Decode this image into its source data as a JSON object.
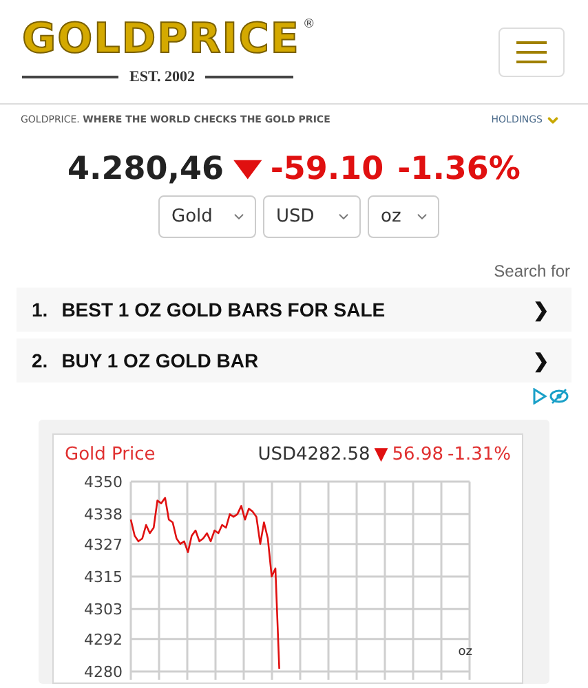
{
  "header": {
    "logo": "GOLDPRICE",
    "registered": "®",
    "established": "EST. 2002"
  },
  "tagline": "GOLDPRICE. **WHERE THE WORLD CHECKS THE GOLD PRICE**",
  "holdings": "HOLDINGS",
  "quote": {
    "price": "4.280,46",
    "arrow": "▼",
    "change": "-59.10",
    "percent": "-1.36%"
  },
  "selectors": [
    {
      "value": "Gold"
    },
    {
      "value": "USD"
    },
    {
      "value": "oz"
    }
  ],
  "search_for": "Search for",
  "ads": [
    {
      "number": "1.",
      "text": "BEST 1 OZ GOLD BARS FOR SALE",
      "arrow": "❯"
    },
    {
      "number": "2.",
      "text": "BUY 1 OZ GOLD BAR",
      "arrow": "❯"
    }
  ],
  "chart": {
    "price": "USD4282.58",
    "arrow": "▼",
    "change": "56.98",
    "percent": "-1.31%",
    "unit": "oz",
    "chart_data": {
      "type": "line",
      "title": "Gold Price",
      "grid": true,
      "ylim": [
        4280,
        4350
      ],
      "yticks": [
        4350,
        4338,
        4327,
        4315,
        4303,
        4292,
        4280
      ],
      "categories": [
        null,
        null,
        null,
        null,
        null,
        null,
        null,
        null,
        null,
        null,
        null,
        null,
        null,
        null,
        null,
        null,
        null,
        null,
        null,
        null,
        null,
        null,
        null,
        null,
        null,
        null,
        null,
        null,
        null,
        null,
        null,
        null,
        null,
        null,
        null,
        null,
        null,
        null,
        null,
        null,
        null,
        null,
        null,
        null,
        null,
        null,
        null,
        null,
        null,
        null,
        null,
        null,
        null,
        null,
        null,
        null,
        null,
        null,
        null,
        null,
        null,
        null,
        null,
        null,
        null,
        null,
        null,
        null,
        null,
        null,
        null,
        null,
        null,
        null,
        null,
        null,
        null,
        null,
        null,
        null,
        null,
        null,
        null,
        null,
        null,
        null,
        null,
        null,
        null,
        null
      ],
      "series": [
        {
          "color": "#e01010",
          "values": [
            4336,
            4330,
            4328,
            4329,
            4334,
            4331,
            4333,
            4343,
            4342,
            4344,
            4336,
            4335,
            4329,
            4327,
            4328,
            4324,
            4330,
            4332,
            4328,
            4329,
            4331,
            4328,
            4332,
            4331,
            4334,
            4333,
            4338,
            4337,
            4338,
            4341,
            4336,
            4340,
            4339,
            4337,
            4327,
            4335,
            4329,
            4315,
            4318,
            4281,
            null,
            null,
            null,
            null,
            null,
            null,
            null,
            null,
            null,
            null,
            null,
            null,
            null,
            null,
            null,
            null,
            null,
            null,
            null,
            null,
            null,
            null,
            null,
            null,
            null,
            null,
            null,
            null,
            null,
            null,
            null,
            null,
            null,
            null,
            null,
            null,
            null,
            null,
            null,
            null,
            null,
            null,
            null,
            null,
            null,
            null,
            null,
            null,
            null,
            null
          ]
        }
      ]
    }
  }
}
